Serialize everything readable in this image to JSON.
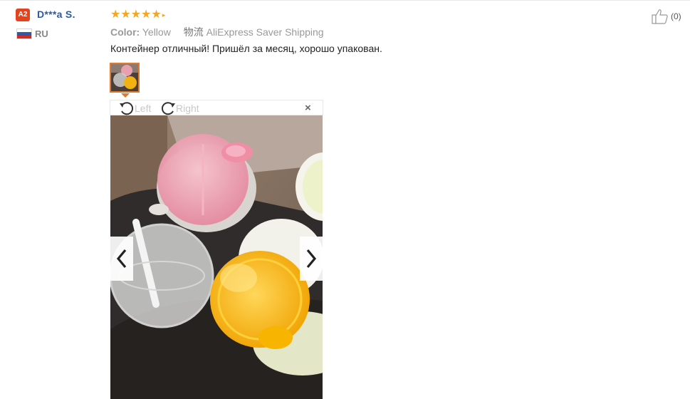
{
  "review": {
    "user": {
      "level_badge": "A2",
      "name": "D***a S.",
      "country": "RU",
      "flag_colors": [
        "#ffffff",
        "#2c5aa8",
        "#d52b1e"
      ]
    },
    "rating": {
      "stars": 5,
      "max": 5
    },
    "color_label": "Color:",
    "color_value": "Yellow",
    "shipping_label": "物流",
    "shipping_value": "AliExpress Saver Shipping",
    "text": "Контейнер отличный! Пришёл за месяц, хорошо упакован.",
    "helpful": {
      "icon": "thumbs-up-icon",
      "count": "(0)"
    }
  },
  "viewer": {
    "rotate_left_label": "Left",
    "rotate_right_label": "Right",
    "close_icon": "close-icon",
    "prev_icon": "chevron-left-icon",
    "next_icon": "chevron-right-icon"
  },
  "colors": {
    "accent": "#e0782e",
    "star": "#f5a623",
    "username": "#2d5a9e",
    "badge": "#e5421e"
  }
}
